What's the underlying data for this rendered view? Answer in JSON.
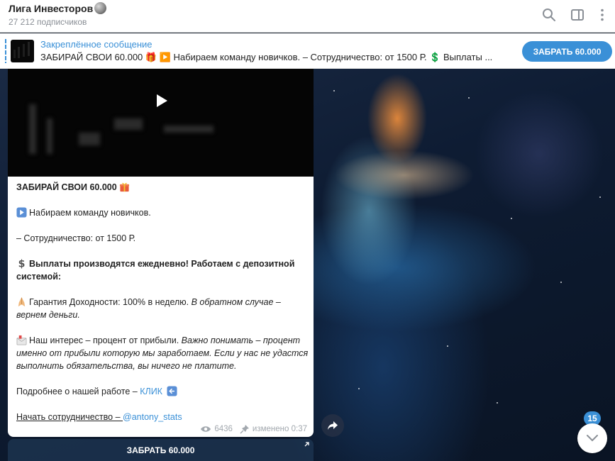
{
  "header": {
    "title": "Лига Инвесторов",
    "subtitle": "27 212 подписчиков",
    "icons": [
      "search-icon",
      "sidebar-toggle-icon",
      "more-vertical-icon"
    ]
  },
  "pinned": {
    "label": "Закреплённое сообщение",
    "text": "ЗАБИРАЙ СВОИ 60.000 🎁 ▶️ Набираем команду новичков.  – Сотрудничество: от 1500 Р. 💲 Выплаты ...",
    "button": "ЗАБРАТЬ 60.000"
  },
  "message": {
    "title": "ЗАБИРАЙ СВОИ 60.000",
    "line1": "Набираем команду новичков.",
    "line2": "– Сотрудничество: от 1500 Р.",
    "payouts": "Выплаты производятся ежедневно! Работаем с депозитной системой:",
    "guarantee_plain": "Гарантия Доходности: 100% в неделю. ",
    "guarantee_italic": "В обратном случае – вернем деньги.",
    "interest_plain": "Наш интерес – процент от прибыли. ",
    "interest_italic": "Важно понимать – процент именно от прибыли которую мы заработаем. Если у нас не удастся выполнить обязательства, вы ничего не платите.",
    "more_text": "Подробнее о нашей работе – ",
    "more_link": "КЛИК",
    "start_text": "Начать сотрудничество – ",
    "start_link": "@antony_stats",
    "views": "6436",
    "edited": "изменено 0:37"
  },
  "keyboard_button": "ЗАБРАТЬ 60.000",
  "unread_count": "15",
  "colors": {
    "accent": "#3a90d7",
    "text": "#222222",
    "muted": "#8a8f96"
  }
}
